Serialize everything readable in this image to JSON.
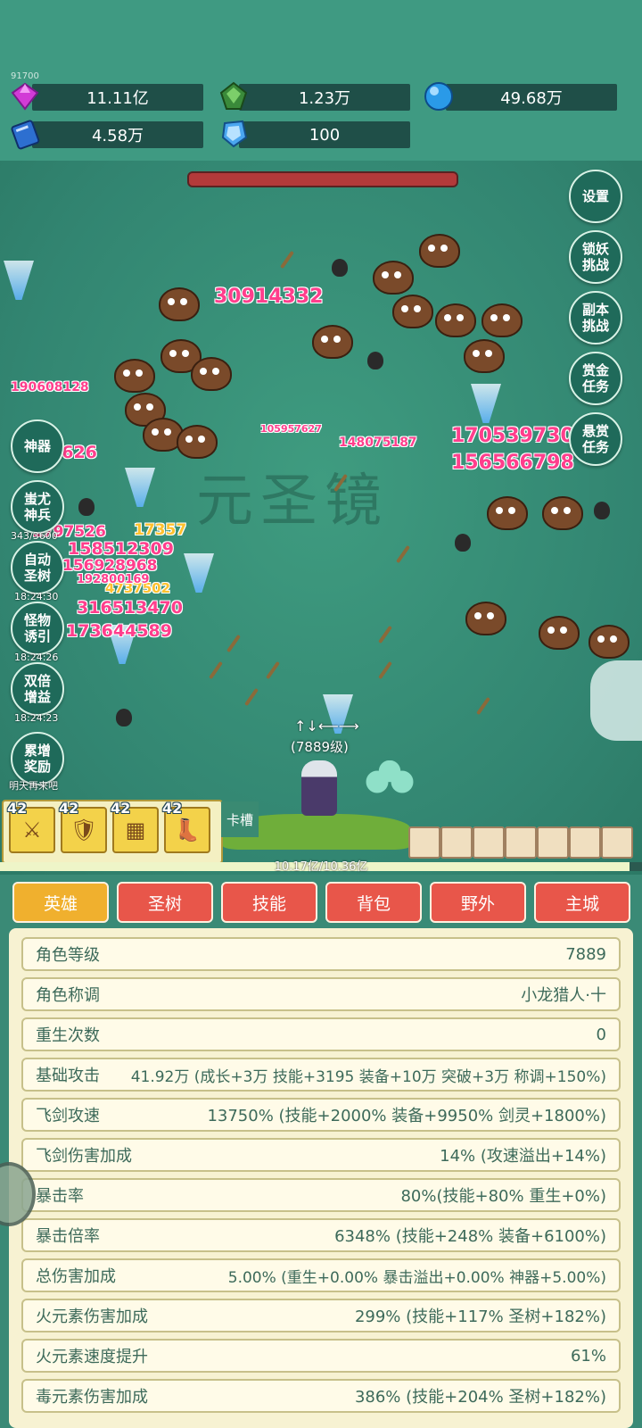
{
  "top": {
    "tiny_text": "91700",
    "resources": [
      {
        "icon": "gem-icon",
        "value": "11.11亿"
      },
      {
        "icon": "green-crystal-icon",
        "value": "1.23万"
      },
      {
        "icon": "blue-orb-icon",
        "value": "49.68万"
      },
      {
        "icon": "book-icon",
        "value": "4.58万"
      },
      {
        "icon": "shield-crystal-icon",
        "value": "100"
      }
    ]
  },
  "arena": {
    "right_buttons": [
      {
        "label": "设置"
      },
      {
        "label": "锁妖挑战"
      },
      {
        "label": "副本挑战"
      },
      {
        "label": "赏金任务"
      },
      {
        "label": "悬赏任务"
      }
    ],
    "left_buttons": [
      {
        "label": "神器",
        "timer": ""
      },
      {
        "label": "蚩尤神兵",
        "timer": "343/3600"
      },
      {
        "label": "自动圣树",
        "timer": "18:24:30"
      },
      {
        "label": "怪物诱引",
        "timer": "18:24:26"
      },
      {
        "label": "双倍增益",
        "timer": "18:24:23"
      },
      {
        "label": "累增奖励",
        "timer": "明天再来吧"
      }
    ],
    "watermark": "元圣镜",
    "hero_arrows": "↑↓⟵⟶",
    "hero_level": "(7889级)",
    "damage_numbers": [
      "30914332",
      "190608128",
      "170539730",
      "156566798",
      "148075187",
      "173644589",
      "316513470",
      "158512309",
      "156928968",
      "1797526",
      "4737502",
      "105957627",
      "17357",
      "1626",
      "192800169"
    ]
  },
  "slots": {
    "items": [
      {
        "level": "42",
        "icon": "sword-icon"
      },
      {
        "level": "42",
        "icon": "armor-icon"
      },
      {
        "level": "42",
        "icon": "bracer-icon"
      },
      {
        "level": "42",
        "icon": "boots-icon"
      }
    ],
    "kacao_label": "卡槽"
  },
  "exp": {
    "text": "10.17亿/10.36亿",
    "fraction": 0.98
  },
  "tabs": [
    "英雄",
    "圣树",
    "技能",
    "背包",
    "野外",
    "主城"
  ],
  "stats": [
    {
      "label": "角色等级",
      "value": "7889"
    },
    {
      "label": "角色称调",
      "value": "小龙猎人·十"
    },
    {
      "label": "重生次数",
      "value": "0"
    },
    {
      "label": "基础攻击",
      "value": "41.92万 (成长+3万 技能+3195 装备+10万 突破+3万 称调+150%)"
    },
    {
      "label": "飞剑攻速",
      "value": "13750% (技能+2000% 装备+9950% 剑灵+1800%)"
    },
    {
      "label": "飞剑伤害加成",
      "value": "14% (攻速溢出+14%)"
    },
    {
      "label": "暴击率",
      "value": "80%(技能+80% 重生+0%)"
    },
    {
      "label": "暴击倍率",
      "value": "6348% (技能+248% 装备+6100%)"
    },
    {
      "label": "总伤害加成",
      "value": "5.00% (重生+0.00% 暴击溢出+0.00% 神器+5.00%)"
    },
    {
      "label": "火元素伤害加成",
      "value": "299% (技能+117% 圣树+182%)"
    },
    {
      "label": "火元素速度提升",
      "value": "61%"
    },
    {
      "label": "毒元素伤害加成",
      "value": "386% (技能+204% 圣树+182%)"
    }
  ],
  "colors": {
    "accent": "#f0b02e",
    "tab": "#e8564a",
    "damage": "#ff3e8c"
  }
}
